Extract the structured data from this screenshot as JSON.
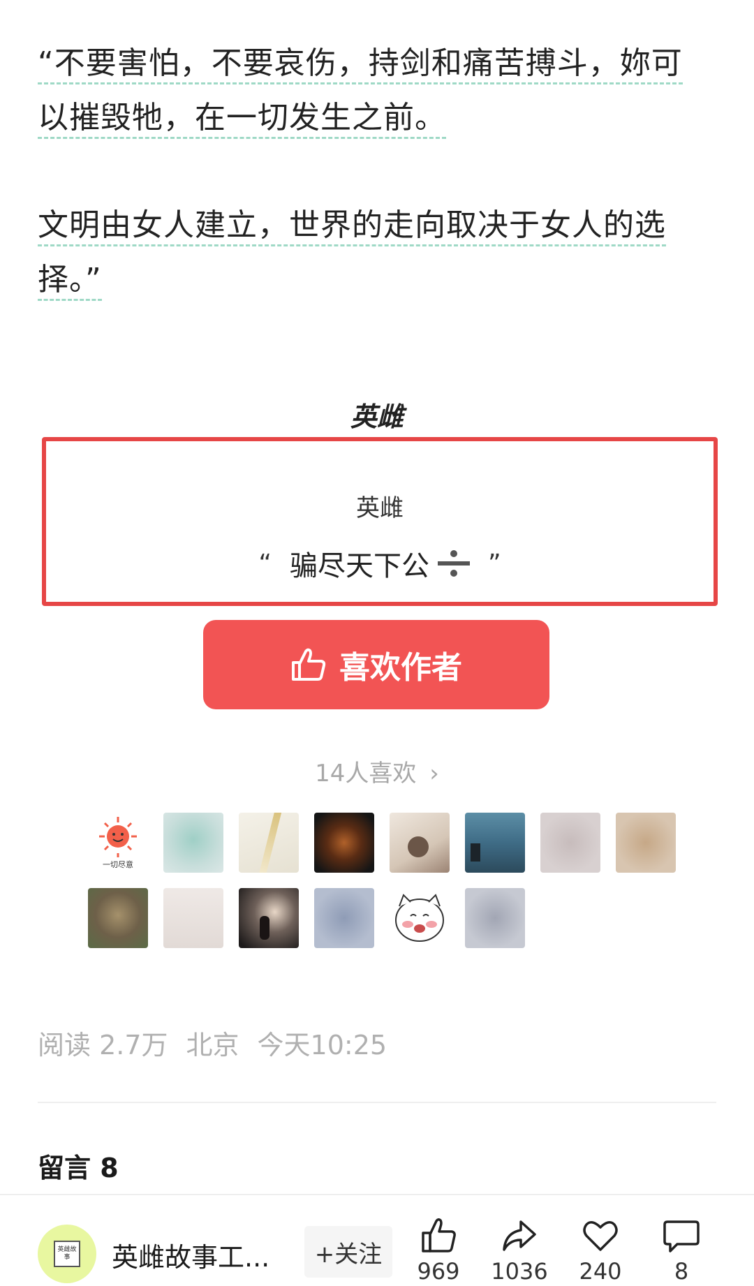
{
  "article": {
    "para1_line1": "“不要害怕，不要哀伤，持剑和痛苦搏斗，妳可",
    "para1_line2": "以摧毁牠，在一切发生之前。",
    "para2_line1": "文明由女人建立，世界的走向取决于女人的选",
    "para2_line2": "择。”"
  },
  "signature": "英雌",
  "reward": {
    "author": "英雌",
    "open_quote": "“",
    "quote_text": "骗尽天下公",
    "close_quote": "”"
  },
  "like_button": {
    "label": "喜欢作者",
    "icon": "thumbs-up-icon"
  },
  "likes": {
    "count_text": "14人喜欢",
    "avatars_row1": [
      "sun-sticker",
      "blurred-teal",
      "pen",
      "tiger",
      "hand-stone",
      "dark-sea",
      "blurred-gray",
      "blurred-tan"
    ],
    "avatars_row2": [
      "owl",
      "blurred-light",
      "child-silhouette",
      "blurred-blue",
      "cartoon-cat",
      "blurred-gray2"
    ],
    "sun_caption": "一切尽意"
  },
  "meta": {
    "reads": "阅读 2.7万",
    "location": "北京",
    "time": "今天10:25"
  },
  "comments": {
    "title": "留言 8"
  },
  "bottom_bar": {
    "account_name": "英雌故事工...",
    "account_logo_text": "英雌故事",
    "follow_label": "+关注",
    "like_count": "969",
    "share_count": "1036",
    "fav_count": "240",
    "comment_count": "8"
  },
  "colors": {
    "accent_red": "#f25454",
    "box_border": "#e64646",
    "underline": "#9fd9c6",
    "muted_text": "#b0b0b0"
  }
}
